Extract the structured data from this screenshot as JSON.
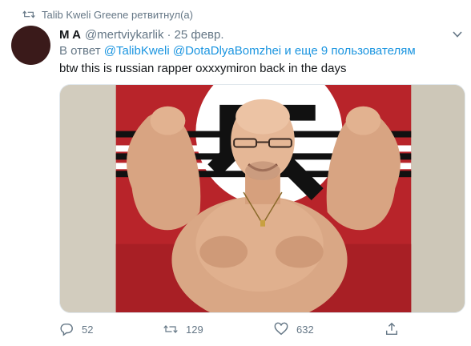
{
  "retweet_context": {
    "text": "Talib Kweli Greene ретвитнул(а)",
    "icon": "retweet-icon"
  },
  "tweet": {
    "author_name": "M A",
    "author_handle": "@mertviykarlik",
    "separator": "·",
    "date": "25 февр.",
    "reply_prefix": "В ответ",
    "reply_mentions": [
      "@TalibKweli",
      "@DotaDlyaBomzhei"
    ],
    "reply_suffix": "и еще 9 пользователям",
    "text": "btw this is russian rapper oxxxymiron back in the days"
  },
  "actions": {
    "reply_count": "52",
    "retweet_count": "129",
    "like_count": "632"
  },
  "colors": {
    "link": "#1b95e0",
    "secondary_text": "#657786",
    "primary_text": "#14171a",
    "flag_red": "#c0252a"
  }
}
